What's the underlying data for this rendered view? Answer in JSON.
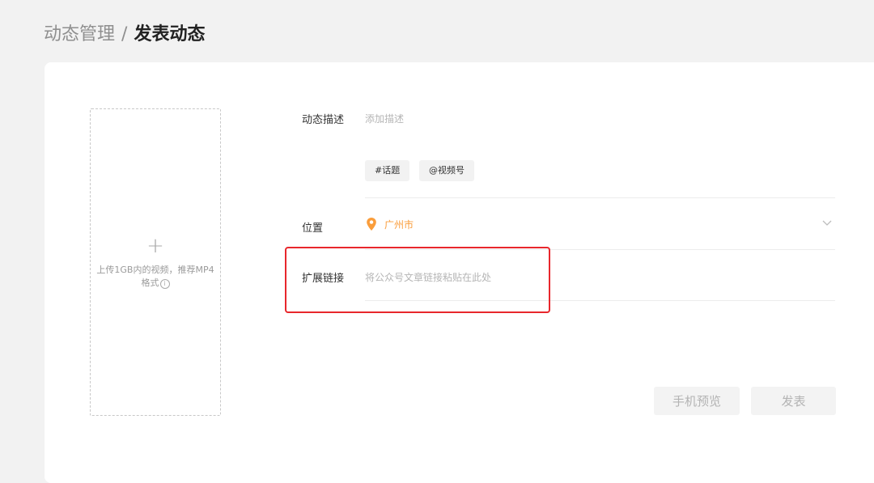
{
  "breadcrumb": {
    "parent": "动态管理",
    "separator": "/",
    "current": "发表动态"
  },
  "upload": {
    "hint": "上传1GB内的视频，推荐MP4格式",
    "plus": "+",
    "info_glyph": "i"
  },
  "form": {
    "description": {
      "label": "动态描述",
      "placeholder": "添加描述"
    },
    "tags": [
      "#话题",
      "@视频号"
    ],
    "location": {
      "label": "位置",
      "value": "广州市"
    },
    "extended_link": {
      "label": "扩展链接",
      "placeholder": "将公众号文章链接粘贴在此处"
    }
  },
  "buttons": {
    "preview": "手机预览",
    "publish": "发表"
  },
  "colors": {
    "location_accent": "#fa9d3b",
    "highlight_border": "#e8272c"
  }
}
